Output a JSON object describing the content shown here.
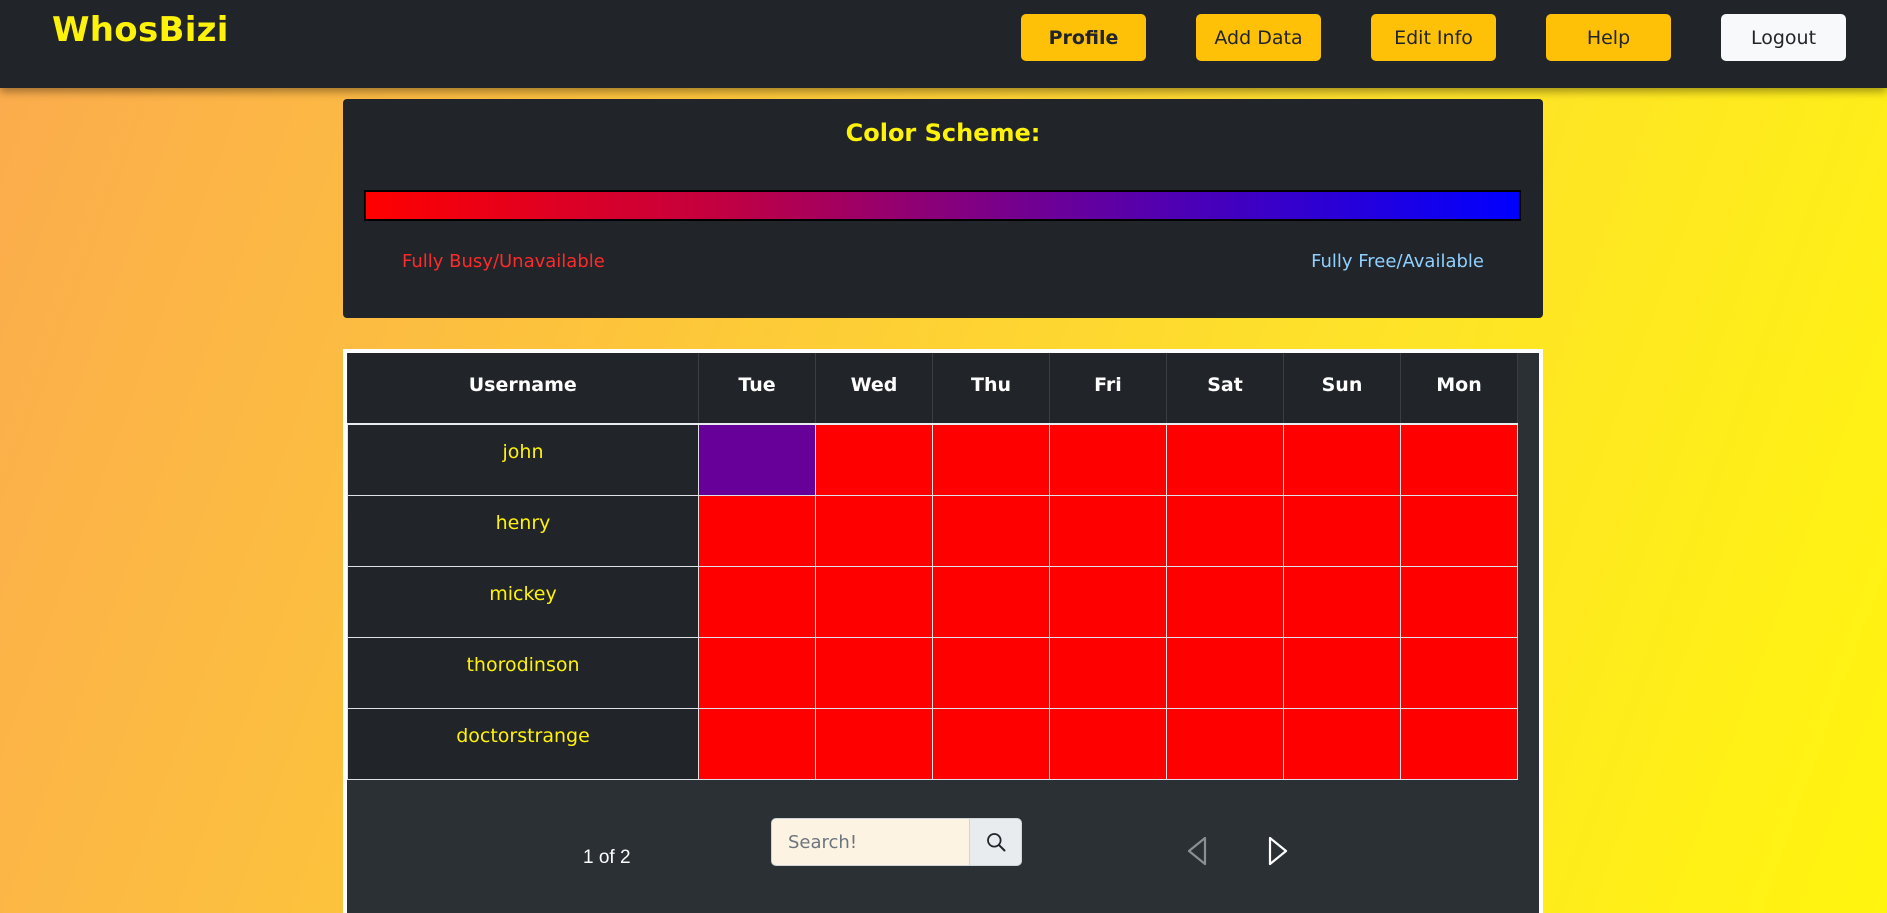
{
  "navbar": {
    "brand": "WhosBizi",
    "buttons": [
      {
        "label": "Profile"
      },
      {
        "label": "Add Data"
      },
      {
        "label": "Edit Info"
      },
      {
        "label": "Help"
      },
      {
        "label": "Logout"
      }
    ]
  },
  "color_scheme": {
    "title": "Color Scheme:",
    "busy_label": "Fully Busy/Unavailable",
    "free_label": "Fully Free/Available",
    "busy_color": "#ff0000",
    "free_color": "#0000ff"
  },
  "table": {
    "headers": [
      "Username",
      "Tue",
      "Wed",
      "Thu",
      "Fri",
      "Sat",
      "Sun",
      "Mon"
    ],
    "rows": [
      {
        "username": "john",
        "colors": [
          "#660099",
          "#ff0000",
          "#ff0000",
          "#ff0000",
          "#ff0000",
          "#ff0000",
          "#ff0000"
        ]
      },
      {
        "username": "henry",
        "colors": [
          "#ff0000",
          "#ff0000",
          "#ff0000",
          "#ff0000",
          "#ff0000",
          "#ff0000",
          "#ff0000"
        ]
      },
      {
        "username": "mickey",
        "colors": [
          "#ff0000",
          "#ff0000",
          "#ff0000",
          "#ff0000",
          "#ff0000",
          "#ff0000",
          "#ff0000"
        ]
      },
      {
        "username": "thorodinson",
        "colors": [
          "#ff0000",
          "#ff0000",
          "#ff0000",
          "#ff0000",
          "#ff0000",
          "#ff0000",
          "#ff0000"
        ]
      },
      {
        "username": "doctorstrange",
        "colors": [
          "#ff0000",
          "#ff0000",
          "#ff0000",
          "#ff0000",
          "#ff0000",
          "#ff0000",
          "#ff0000"
        ]
      }
    ]
  },
  "pagination": {
    "page_text": "1 of 2",
    "prev_icon": "triangle-left-outline-icon",
    "next_icon": "triangle-right-outline-icon"
  },
  "search": {
    "placeholder": "Search!",
    "value": "",
    "icon": "magnifier-icon"
  }
}
